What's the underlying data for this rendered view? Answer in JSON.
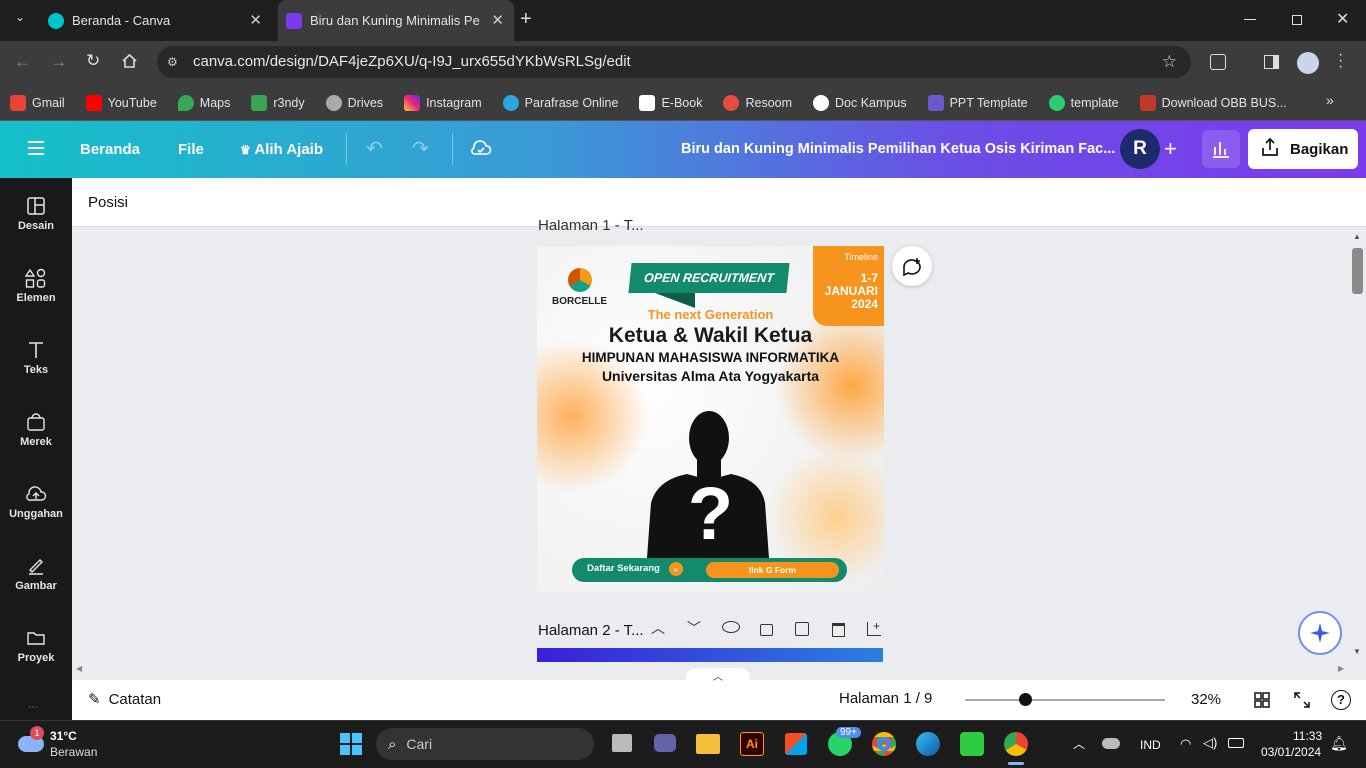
{
  "browser": {
    "tabs": [
      {
        "title": "Beranda - Canva",
        "active": false
      },
      {
        "title": "Biru dan Kuning Minimalis Pemi",
        "active": true
      }
    ],
    "new_tab": "+",
    "url": "canva.com/design/DAF4jeZp6XU/q-I9J_urx655dYKbWsRLSg/edit",
    "bookmarks": [
      "Gmail",
      "YouTube",
      "Maps",
      "r3ndy",
      "Drives",
      "Instagram",
      "Parafrase Online",
      "E-Book",
      "Resoom",
      "Doc Kampus",
      "PPT Template",
      "template",
      "Download OBB BUS..."
    ]
  },
  "canva": {
    "header": {
      "home": "Beranda",
      "file": "File",
      "magic": "Alih Ajaib",
      "doc_title": "Biru dan Kuning Minimalis Pemilihan Ketua Osis Kiriman Fac...",
      "avatar": "R",
      "share": "Bagikan"
    },
    "sidebar": [
      "Desain",
      "Elemen",
      "Teks",
      "Merek",
      "Unggahan",
      "Gambar",
      "Proyek"
    ],
    "position_label": "Posisi",
    "page1_label": "Halaman 1 - T...",
    "page2_label": "Halaman 2 - T...",
    "design": {
      "brand": "BORCELLE",
      "banner": "OPEN RECRUITMENT",
      "timeline_label": "Timeline",
      "timeline_dates": "1-7",
      "timeline_month": "JANUARI",
      "timeline_year": "2024",
      "tagline": "The next Generation",
      "headline": "Ketua & Wakil Ketua",
      "org": "HIMPUNAN MAHASISWA INFORMATIKA",
      "univ": "Universitas Alma Ata Yogyakarta",
      "mystery": "?",
      "cta": "Daftar Sekarang",
      "form": "link G Form"
    },
    "footer": {
      "notes": "Catatan",
      "page_indicator": "Halaman 1 / 9",
      "zoom": "32%",
      "zoom_fraction": 0.3
    }
  },
  "taskbar": {
    "weather_temp": "31°C",
    "weather_desc": "Berawan",
    "weather_badge": "1",
    "search": "Cari",
    "whatsapp_badge": "99+",
    "lang": "IND",
    "time": "11:33",
    "date": "03/01/2024"
  }
}
